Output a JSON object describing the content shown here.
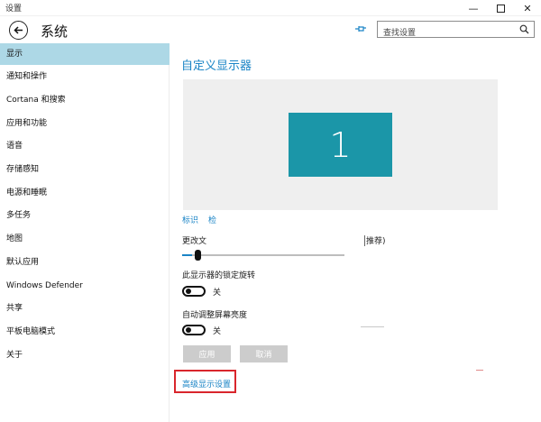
{
  "window": {
    "title": "设置",
    "minimize_icon": "minimize-icon",
    "maximize_icon": "maximize-icon",
    "close_icon": "close-icon"
  },
  "header": {
    "page_title": "系统",
    "back_icon": "back-arrow-icon",
    "pin_icon": "pin-icon",
    "search": {
      "placeholder": "查找设置",
      "icon": "search-icon"
    }
  },
  "sidebar": {
    "active_color": "#add8e6",
    "items": [
      {
        "label": "显示",
        "active": true
      },
      {
        "label": "通知和操作"
      },
      {
        "label": "Cortana 和搜索"
      },
      {
        "label": "应用和功能"
      },
      {
        "label": "语音"
      },
      {
        "label": "存储感知"
      },
      {
        "label": "电源和睡眠"
      },
      {
        "label": "多任务"
      },
      {
        "label": "地图"
      },
      {
        "label": "默认应用"
      },
      {
        "label": "Windows Defender"
      },
      {
        "label": "共享"
      },
      {
        "label": "平板电脑模式"
      },
      {
        "label": "关于"
      }
    ]
  },
  "main": {
    "section_title": "自定义显示器",
    "accent_color": "#1a84c6",
    "monitor_number": "1",
    "monitor_color": "#1b96a8",
    "identify_link": "标识",
    "detect_link": "检",
    "scale_label": "更改文",
    "scale_recommended": "推荐)",
    "scale_slider_fraction": 0.06,
    "rotation_lock": {
      "label": "此显示器的锁定旋转",
      "state": "关"
    },
    "auto_brightness": {
      "label": "自动调整屏幕亮度",
      "state": "关"
    },
    "apply_button": "应用",
    "cancel_button": "取消",
    "advanced_link": "高级显示设置",
    "highlight_color": "#d9262c"
  }
}
